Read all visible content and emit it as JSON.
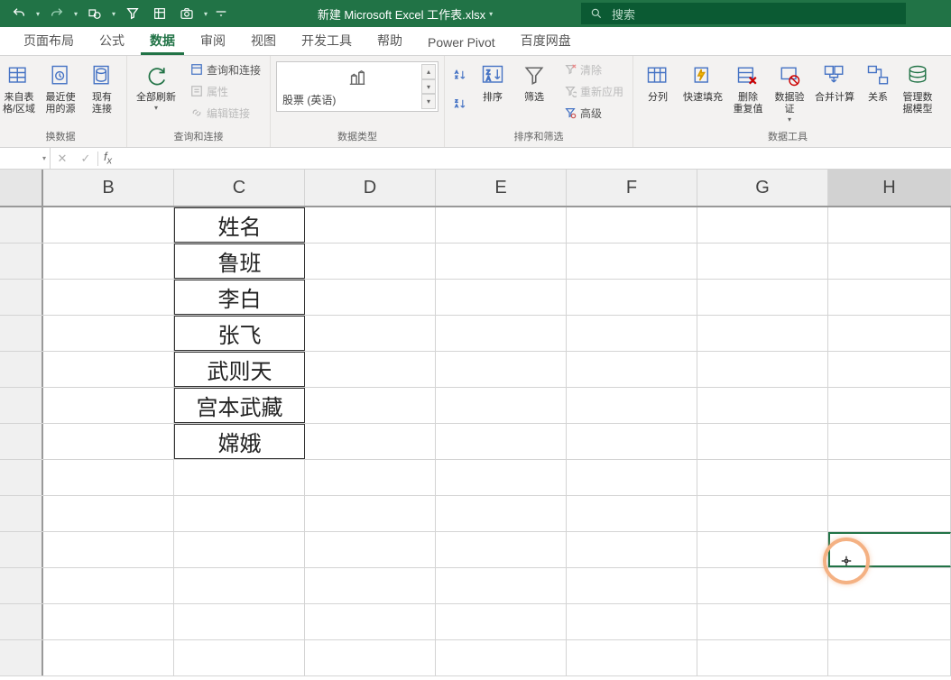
{
  "title": "新建 Microsoft Excel 工作表.xlsx",
  "search": {
    "placeholder": "搜索"
  },
  "tabs": {
    "page_layout": "页面布局",
    "formulas": "公式",
    "data": "数据",
    "review": "审阅",
    "view": "视图",
    "developer": "开发工具",
    "help": "帮助",
    "power_pivot": "Power Pivot",
    "baidu": "百度网盘"
  },
  "ribbon": {
    "get_data_group": {
      "from_table": "来自表\n格/区域",
      "recent": "最近使\n用的源",
      "existing": "现有\n连接",
      "label": "换数据"
    },
    "queries_group": {
      "refresh_all": "全部刷新",
      "queries": "查询和连接",
      "properties": "属性",
      "edit_links": "编辑链接",
      "label": "查询和连接"
    },
    "datatype_group": {
      "stocks": "股票 (英语)",
      "label": "数据类型"
    },
    "sort_group": {
      "sort": "排序",
      "filter": "筛选",
      "clear": "清除",
      "reapply": "重新应用",
      "advanced": "高级",
      "label": "排序和筛选"
    },
    "tools_group": {
      "text_to_cols": "分列",
      "flash_fill": "快速填充",
      "remove_dup": "删除\n重复值",
      "data_valid": "数据验\n证",
      "consolidate": "合并计算",
      "relationships": "关系",
      "data_model": "管理数\n据模型",
      "label": "数据工具"
    }
  },
  "columns": [
    "B",
    "C",
    "D",
    "E",
    "F",
    "G",
    "H"
  ],
  "cell_data": {
    "c1": "姓名",
    "c2": "鲁班",
    "c3": "李白",
    "c4": "张飞",
    "c5": "武则天",
    "c6": "宫本武藏",
    "c7": "嫦娥"
  },
  "name_box": "",
  "formula": ""
}
